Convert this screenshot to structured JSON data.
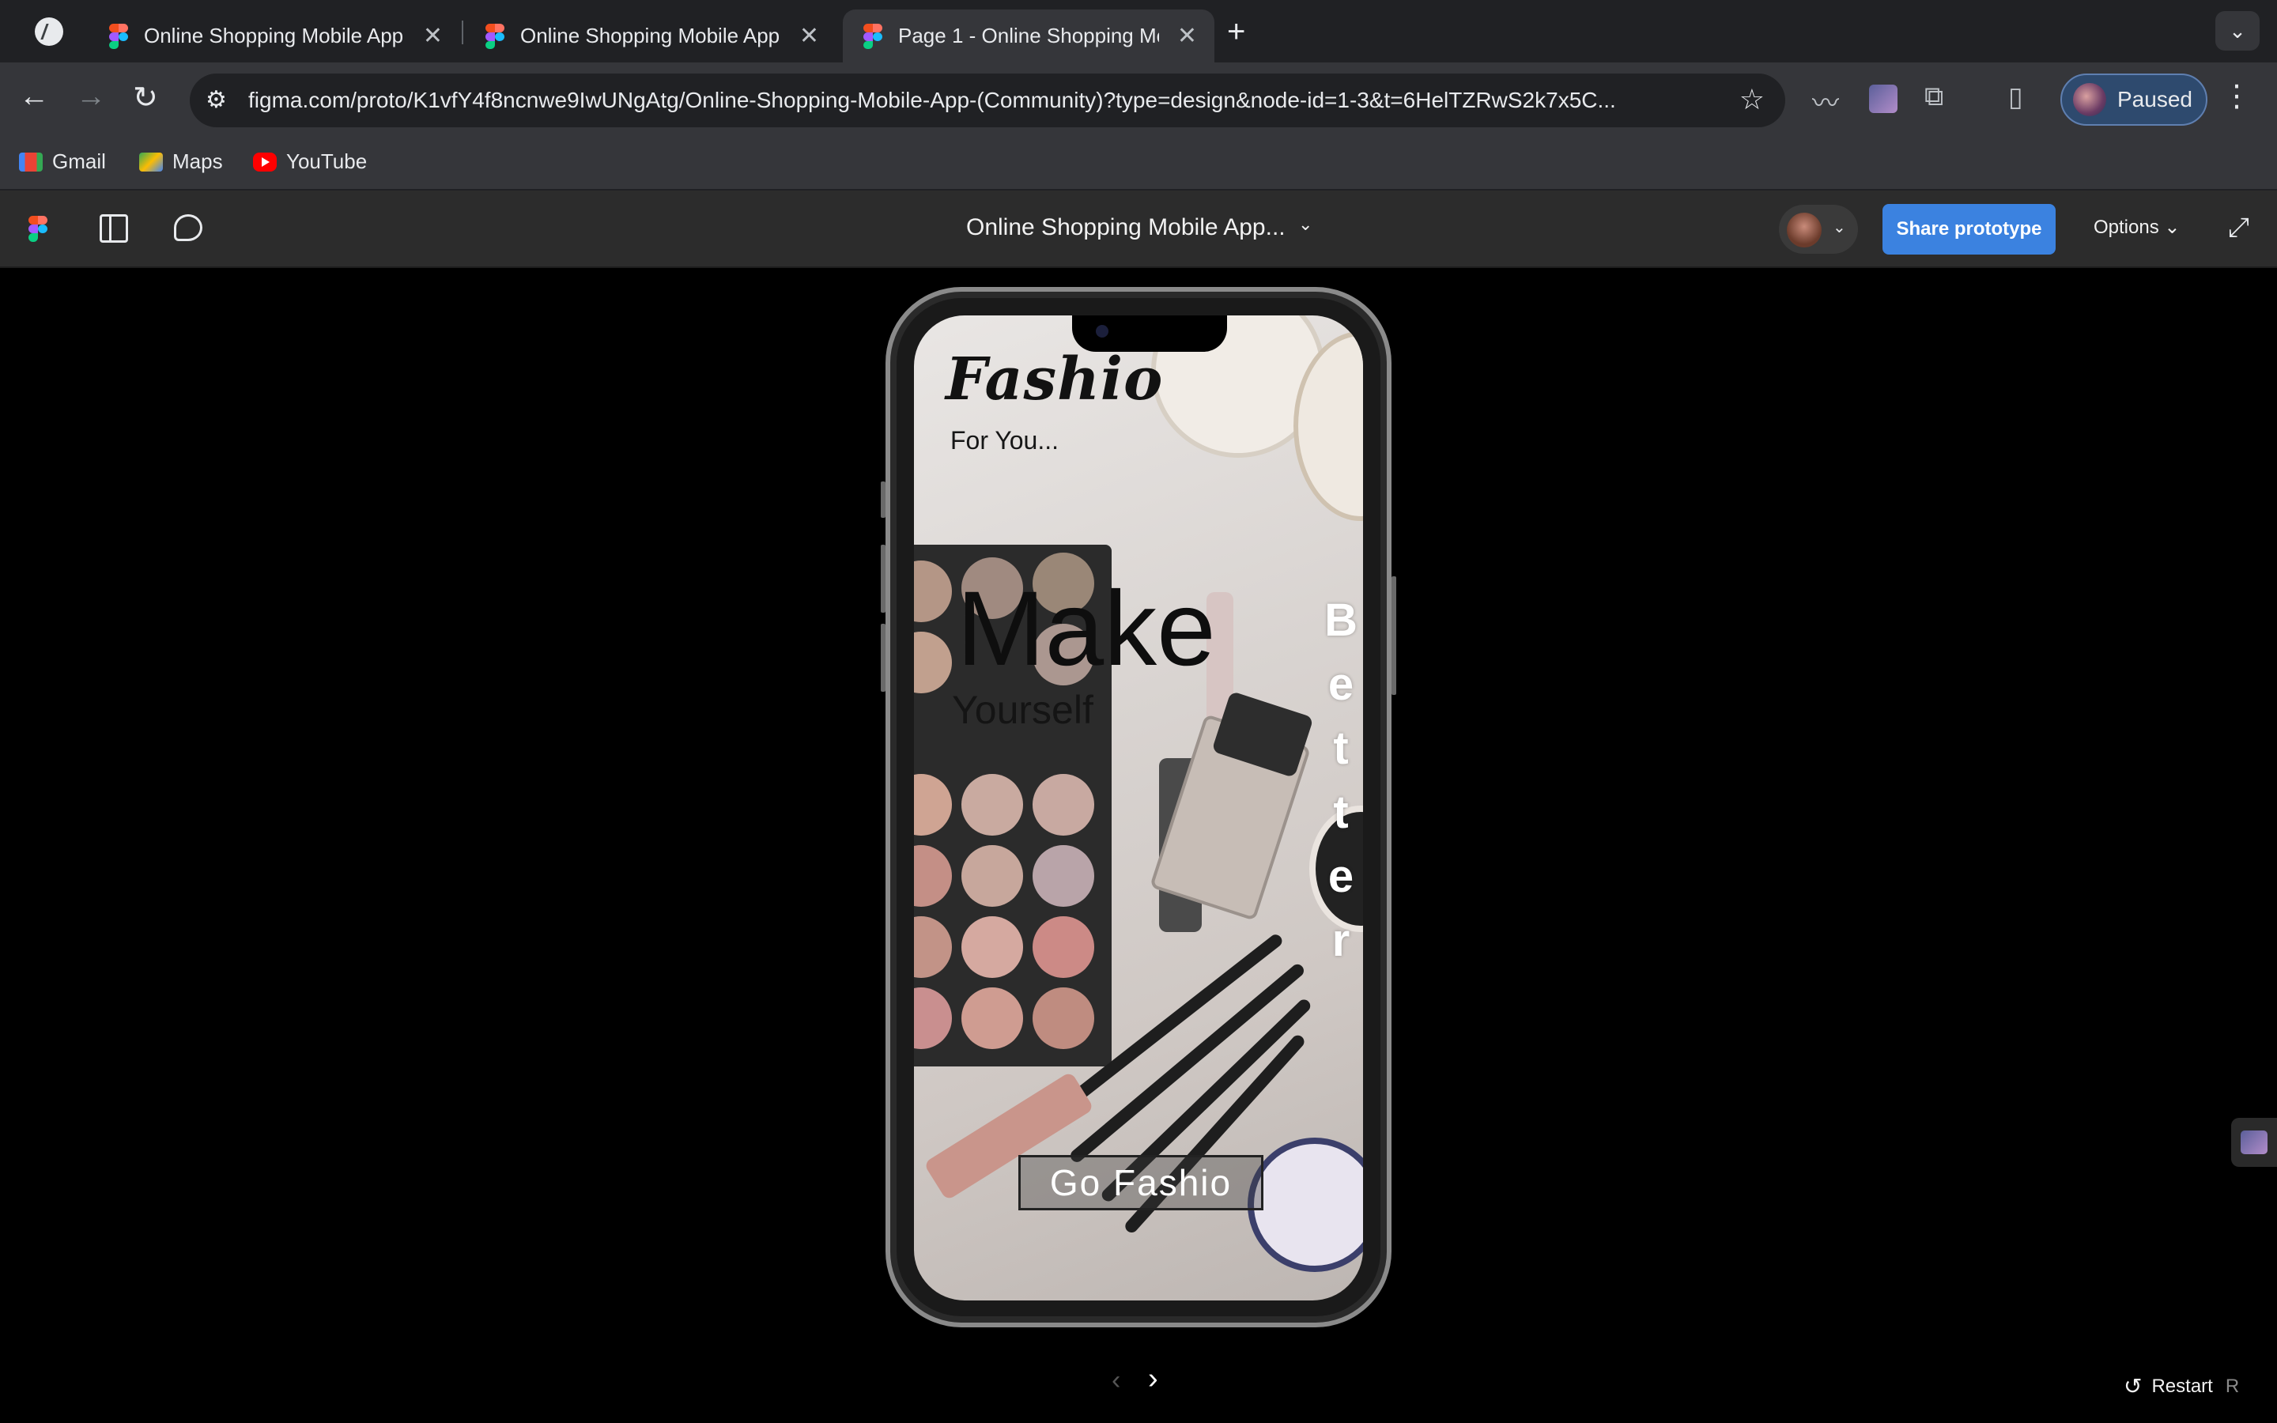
{
  "browser": {
    "tabs": [
      {
        "title": "Online Shopping Mobile App (",
        "active": false
      },
      {
        "title": "Online Shopping Mobile App (",
        "active": false
      },
      {
        "title": "Page 1 - Online Shopping Mo",
        "active": true
      }
    ],
    "url": "figma.com/proto/K1vfY4f8ncnwe9IwUNgAtg/Online-Shopping-Mobile-App-(Community)?type=design&node-id=1-3&t=6HelTZRwS2k7x5C...",
    "profile_label": "Paused",
    "bookmarks": [
      {
        "label": "Gmail",
        "icon": "gmail-icon"
      },
      {
        "label": "Maps",
        "icon": "maps-icon"
      },
      {
        "label": "YouTube",
        "icon": "youtube-icon"
      }
    ]
  },
  "figma": {
    "file_title": "Online Shopping Mobile App...",
    "share_label": "Share prototype",
    "options_label": "Options",
    "restart_label": "Restart",
    "restart_shortcut": "R",
    "accent_color": "#3b82e0"
  },
  "app_screen": {
    "brand": "Fashio",
    "tagline": "For You...",
    "headline": "Make",
    "subheadline": "Yourself",
    "vertical_word_letters": [
      "B",
      "e",
      "t",
      "t",
      "e",
      "r"
    ],
    "cta_label": "Go Fashio"
  }
}
